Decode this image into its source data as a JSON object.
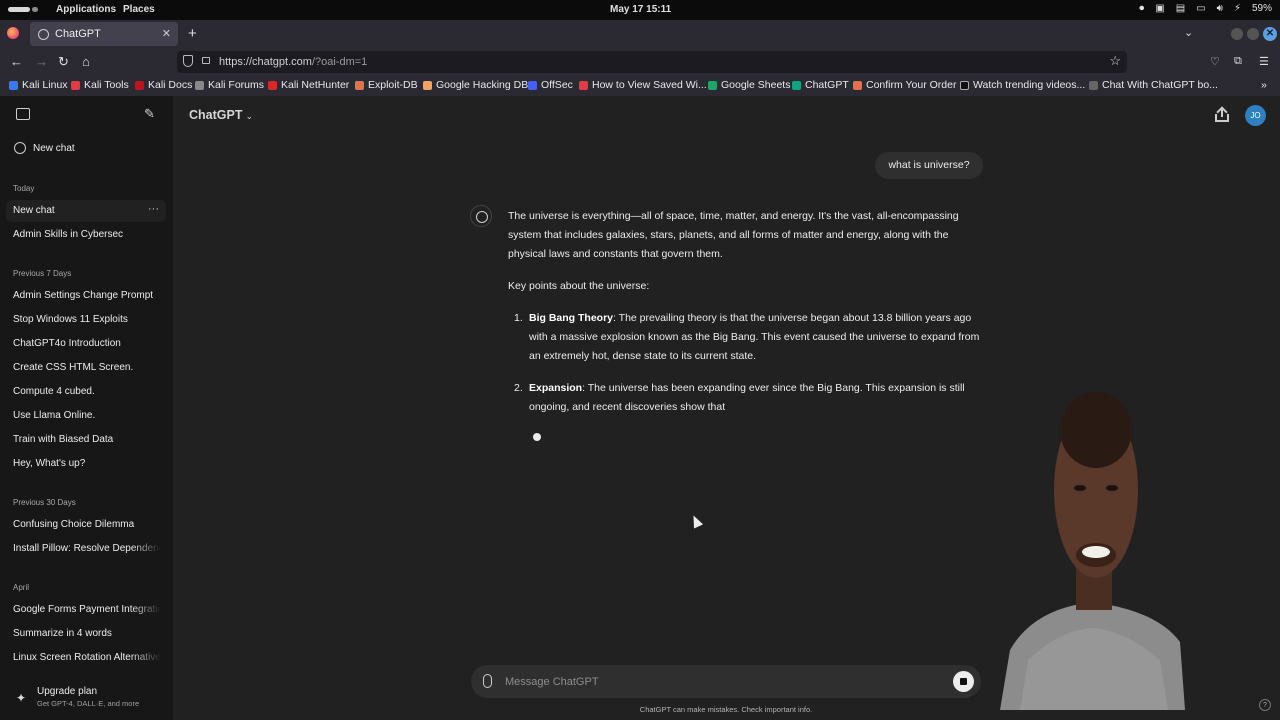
{
  "system_bar": {
    "applications": "Applications",
    "places": "Places",
    "datetime": "May 17  15:11",
    "battery": "59%"
  },
  "browser": {
    "tab_title": "ChatGPT",
    "url_host": "https://chatgpt.com",
    "url_path": "/?oai-dm=1",
    "bookmarks": [
      {
        "label": "Kali Linux",
        "color": "#367bf0"
      },
      {
        "label": "Kali Tools",
        "color": "#e63946"
      },
      {
        "label": "Kali Docs",
        "color": "#c1121f"
      },
      {
        "label": "Kali Forums",
        "color": "#888888"
      },
      {
        "label": "Kali NetHunter",
        "color": "#d62828"
      },
      {
        "label": "Exploit-DB",
        "color": "#e76f51"
      },
      {
        "label": "Google Hacking DB",
        "color": "#f4a261"
      },
      {
        "label": "OffSec",
        "color": "#4361ee"
      },
      {
        "label": "How to View Saved Wi...",
        "color": "#e63946"
      },
      {
        "label": "Google Sheets",
        "color": "#21a366"
      },
      {
        "label": "ChatGPT",
        "color": "#10a37f"
      },
      {
        "label": "Confirm Your Order",
        "color": "#e76f51"
      },
      {
        "label": "Watch trending videos...",
        "color": "#111111"
      },
      {
        "label": "Chat With ChatGPT bo...",
        "color": "#666666"
      }
    ]
  },
  "sidebar": {
    "new_chat": "New chat",
    "sections": [
      {
        "title": "Today",
        "items": [
          "New chat",
          "Admin Skills in Cybersec"
        ]
      },
      {
        "title": "Previous 7 Days",
        "items": [
          "Admin Settings Change Prompt",
          "Stop Windows 11 Exploits",
          "ChatGPT4o Introduction",
          "Create CSS HTML Screen.",
          "Compute 4 cubed.",
          "Use Llama Online.",
          "Train with Biased Data",
          "Hey, What's up?"
        ]
      },
      {
        "title": "Previous 30 Days",
        "items": [
          "Confusing Choice Dilemma",
          "Install Pillow: Resolve Dependencies"
        ]
      },
      {
        "title": "April",
        "items": [
          "Google Forms Payment Integration",
          "Summarize in 4 words",
          "Linux Screen Rotation Alternatives"
        ]
      }
    ],
    "upgrade_title": "Upgrade plan",
    "upgrade_subtitle": "Get GPT-4, DALL·E, and more"
  },
  "header": {
    "model": "ChatGPT",
    "avatar_initials": "JO"
  },
  "conversation": {
    "user_message": "what is universe?",
    "intro": "The universe is everything—all of space, time, matter, and energy. It's the vast, all-encompassing system that includes galaxies, stars, planets, and all forms of matter and energy, along with the physical laws and constants that govern them.",
    "key_points_heading": "Key points about the universe:",
    "points": [
      {
        "num": "1.",
        "title": "Big Bang Theory",
        "text": ": The prevailing theory is that the universe began about 13.8 billion years ago with a massive explosion known as the Big Bang. This event caused the universe to expand from an extremely hot, dense state to its current state."
      },
      {
        "num": "2.",
        "title": "Expansion",
        "text": ": The universe has been expanding ever since the Big Bang. This expansion is still ongoing, and recent discoveries show that"
      }
    ]
  },
  "composer": {
    "placeholder": "Message ChatGPT",
    "disclaimer": "ChatGPT can make mistakes. Check important info."
  }
}
